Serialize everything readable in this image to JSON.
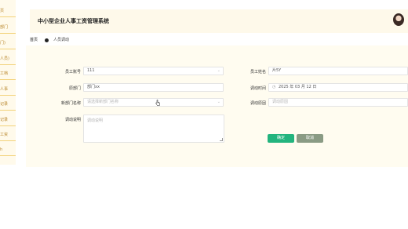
{
  "sidebar": {
    "items": [
      {
        "label": "页"
      },
      {
        "label": "部门"
      },
      {
        "label": "门)"
      },
      {
        "label": "人员)"
      },
      {
        "label": "工档"
      },
      {
        "label": "人事"
      },
      {
        "label": "记录"
      },
      {
        "label": "记录"
      },
      {
        "label": "工资"
      },
      {
        "label": "h"
      }
    ]
  },
  "header": {
    "title": "中小型企业人事工资管理系统"
  },
  "breadcrumb": {
    "home": "首页",
    "current": "人员调动"
  },
  "form": {
    "employee_id_label": "员工账号",
    "employee_id_value": "111",
    "employee_name_label": "员工姓名",
    "employee_name_value": "片5Y",
    "dept_label": "原部门",
    "dept_value": "部门xx",
    "transfer_time_label": "调动时间",
    "transfer_time_value": "2025 年 03 月 12 日",
    "new_dept_label": "新部门名称",
    "new_dept_placeholder": "请选择新部门名称",
    "reason_label": "调动原因",
    "reason_placeholder": "调动原因",
    "note_label": "调动说明",
    "note_placeholder": "调动说明"
  },
  "buttons": {
    "ok": "确定",
    "cancel": "取消"
  },
  "colors": {
    "sidebar_bg": "#fffaeb",
    "header_bg": "#fef9ea",
    "ok_button": "#23b47e",
    "cancel_button": "#8a9b84"
  }
}
